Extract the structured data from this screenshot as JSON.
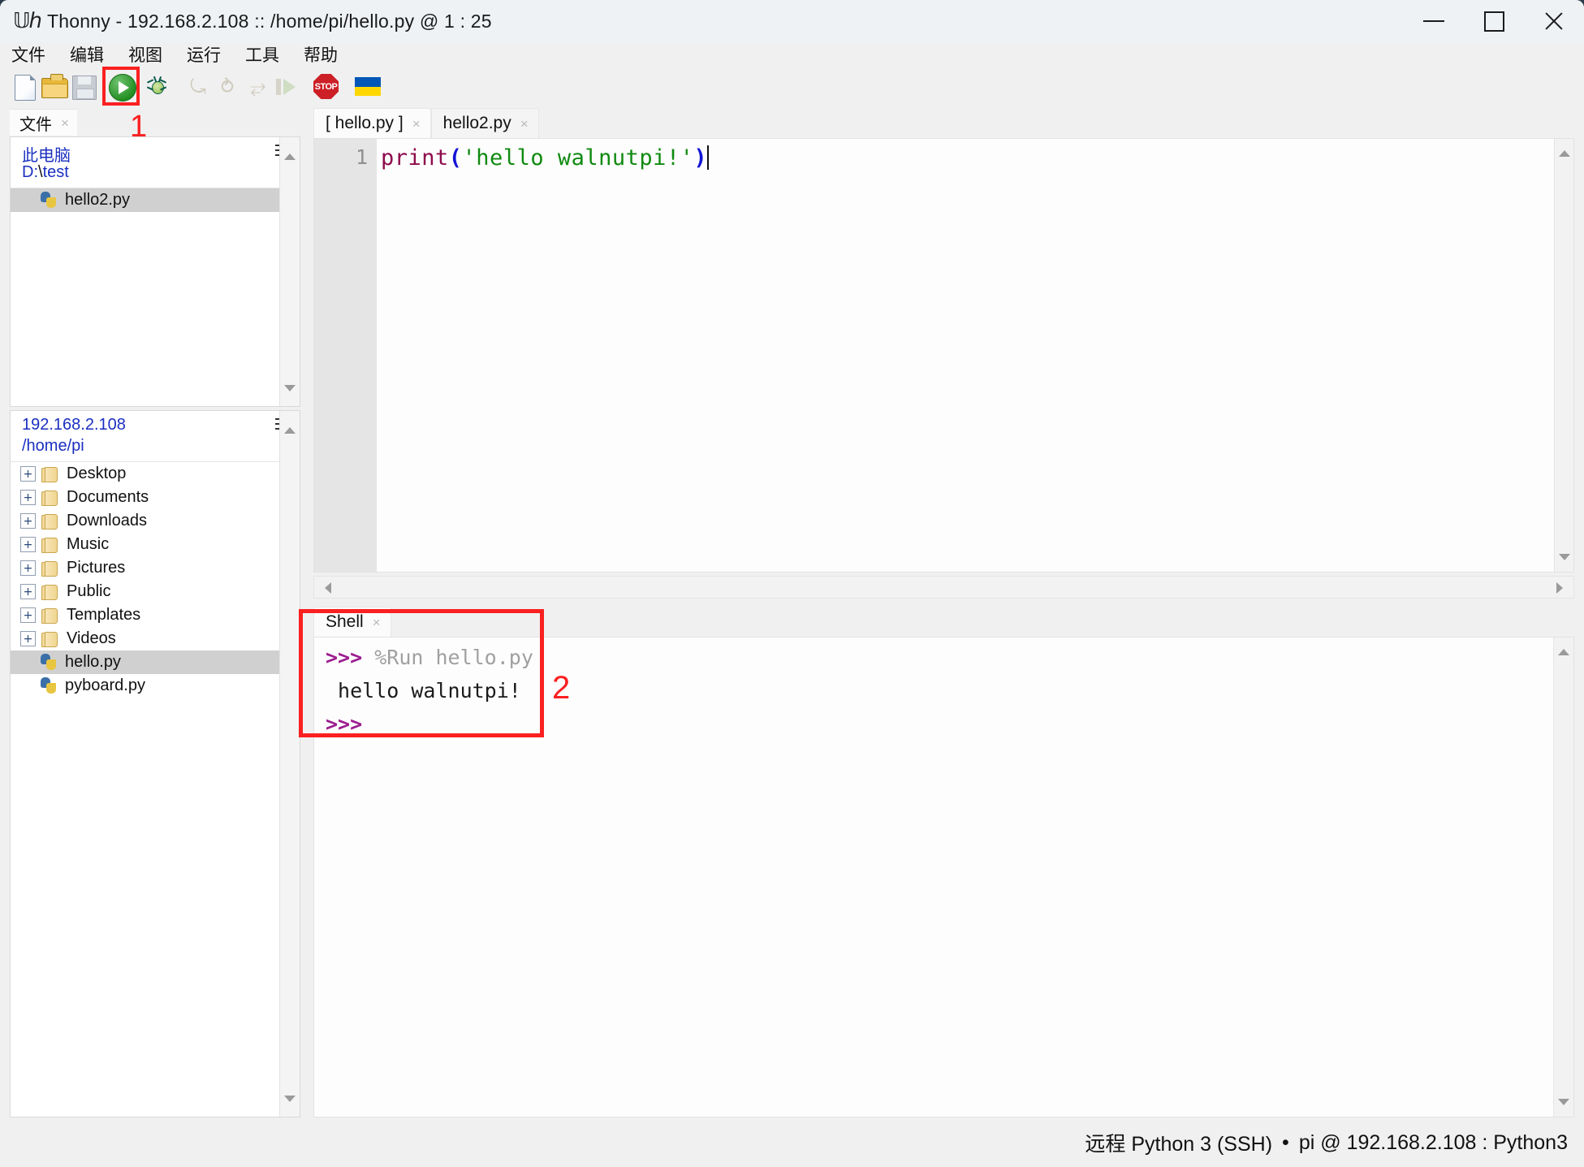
{
  "window": {
    "app_icon": "thonny-logo-icon",
    "title": "Thonny  -  192.168.2.108 :: /home/pi/hello.py  @  1 : 25",
    "minimize_label": "minimize-icon",
    "maximize_label": "maximize-icon",
    "close_label": "close-icon"
  },
  "menubar": {
    "items": [
      {
        "label": "文件",
        "name": "menu-file"
      },
      {
        "label": "编辑",
        "name": "menu-edit"
      },
      {
        "label": "视图",
        "name": "menu-view"
      },
      {
        "label": "运行",
        "name": "menu-run"
      },
      {
        "label": "工具",
        "name": "menu-tools"
      },
      {
        "label": "帮助",
        "name": "menu-help"
      }
    ]
  },
  "toolbar": {
    "buttons": [
      {
        "icon": "new-file-icon",
        "name": "new-file-button"
      },
      {
        "icon": "open-file-icon",
        "name": "open-file-button"
      },
      {
        "icon": "save-file-icon",
        "name": "save-file-button"
      },
      {
        "icon": "run-icon",
        "name": "run-button"
      },
      {
        "icon": "debug-icon",
        "name": "debug-button"
      },
      {
        "icon": "step-over-icon",
        "name": "step-over-button"
      },
      {
        "icon": "step-into-icon",
        "name": "step-into-button"
      },
      {
        "icon": "step-out-icon",
        "name": "step-out-button"
      },
      {
        "icon": "resume-icon",
        "name": "resume-button"
      },
      {
        "icon": "stop-icon",
        "name": "stop-button"
      },
      {
        "icon": "ukraine-flag-icon",
        "name": "support-ukraine-button"
      }
    ],
    "stop_label": "STOP"
  },
  "annotations": {
    "marker_one": "1",
    "marker_two": "2"
  },
  "files_panel": {
    "tab_label": "文件",
    "tab_close": "×",
    "local": {
      "root_label": "此电脑",
      "path_label": "D:\\ test",
      "path_prefix": "D:",
      "path_sep": "\\",
      "path_name": "test",
      "menu_icon": "hamburger-icon",
      "items": [
        {
          "label": "hello2.py",
          "icon": "python-file-icon",
          "selected": true,
          "expandable": false
        }
      ]
    },
    "remote": {
      "host_label": "192.168.2.108",
      "path_label": "/home/pi",
      "menu_icon": "hamburger-icon",
      "items": [
        {
          "label": "Desktop",
          "icon": "folder-icon",
          "selected": false,
          "expandable": true,
          "expander": "+"
        },
        {
          "label": "Documents",
          "icon": "folder-icon",
          "selected": false,
          "expandable": true,
          "expander": "+"
        },
        {
          "label": "Downloads",
          "icon": "folder-icon",
          "selected": false,
          "expandable": true,
          "expander": "+"
        },
        {
          "label": "Music",
          "icon": "folder-icon",
          "selected": false,
          "expandable": true,
          "expander": "+"
        },
        {
          "label": "Pictures",
          "icon": "folder-icon",
          "selected": false,
          "expandable": true,
          "expander": "+"
        },
        {
          "label": "Public",
          "icon": "folder-icon",
          "selected": false,
          "expandable": true,
          "expander": "+"
        },
        {
          "label": "Templates",
          "icon": "folder-icon",
          "selected": false,
          "expandable": true,
          "expander": "+"
        },
        {
          "label": "Videos",
          "icon": "folder-icon",
          "selected": false,
          "expandable": true,
          "expander": "+"
        },
        {
          "label": "hello.py",
          "icon": "python-file-icon",
          "selected": true,
          "expandable": false,
          "expander": ""
        },
        {
          "label": "pyboard.py",
          "icon": "python-file-icon",
          "selected": false,
          "expandable": false,
          "expander": ""
        }
      ]
    }
  },
  "editor": {
    "tabs": [
      {
        "label": "[ hello.py ]",
        "close": "×",
        "active": true
      },
      {
        "label": "hello2.py",
        "close": "×",
        "active": false
      }
    ],
    "line_number": "1",
    "code": {
      "fn": "print",
      "open_paren": "(",
      "string": "'hello walnutpi!'",
      "close_paren": ")"
    }
  },
  "shell": {
    "tab_label": "Shell",
    "tab_close": "×",
    "lines": [
      {
        "prompt": ">>>",
        "command": "%Run hello.py",
        "output": ""
      },
      {
        "prompt": "",
        "command": "",
        "output": " hello walnutpi!"
      },
      {
        "prompt": ">>>",
        "command": "",
        "output": ""
      }
    ],
    "prompt_1": ">>>",
    "command_1": "%Run hello.py",
    "output_1": " hello walnutpi!",
    "prompt_2": ">>>"
  },
  "statusbar": {
    "interpreter": "远程 Python 3 (SSH)",
    "separator": "•",
    "connection": "pi @ 192.168.2.108 : Python3"
  },
  "colors": {
    "accent_red": "#fb2020",
    "run_green": "#1f8c1f",
    "link_blue": "#1a2fc0",
    "string_green": "#108a10",
    "function_magenta": "#8e0b4c",
    "paren_blue": "#1414d6",
    "prompt_purple": "#9b1b8e"
  }
}
